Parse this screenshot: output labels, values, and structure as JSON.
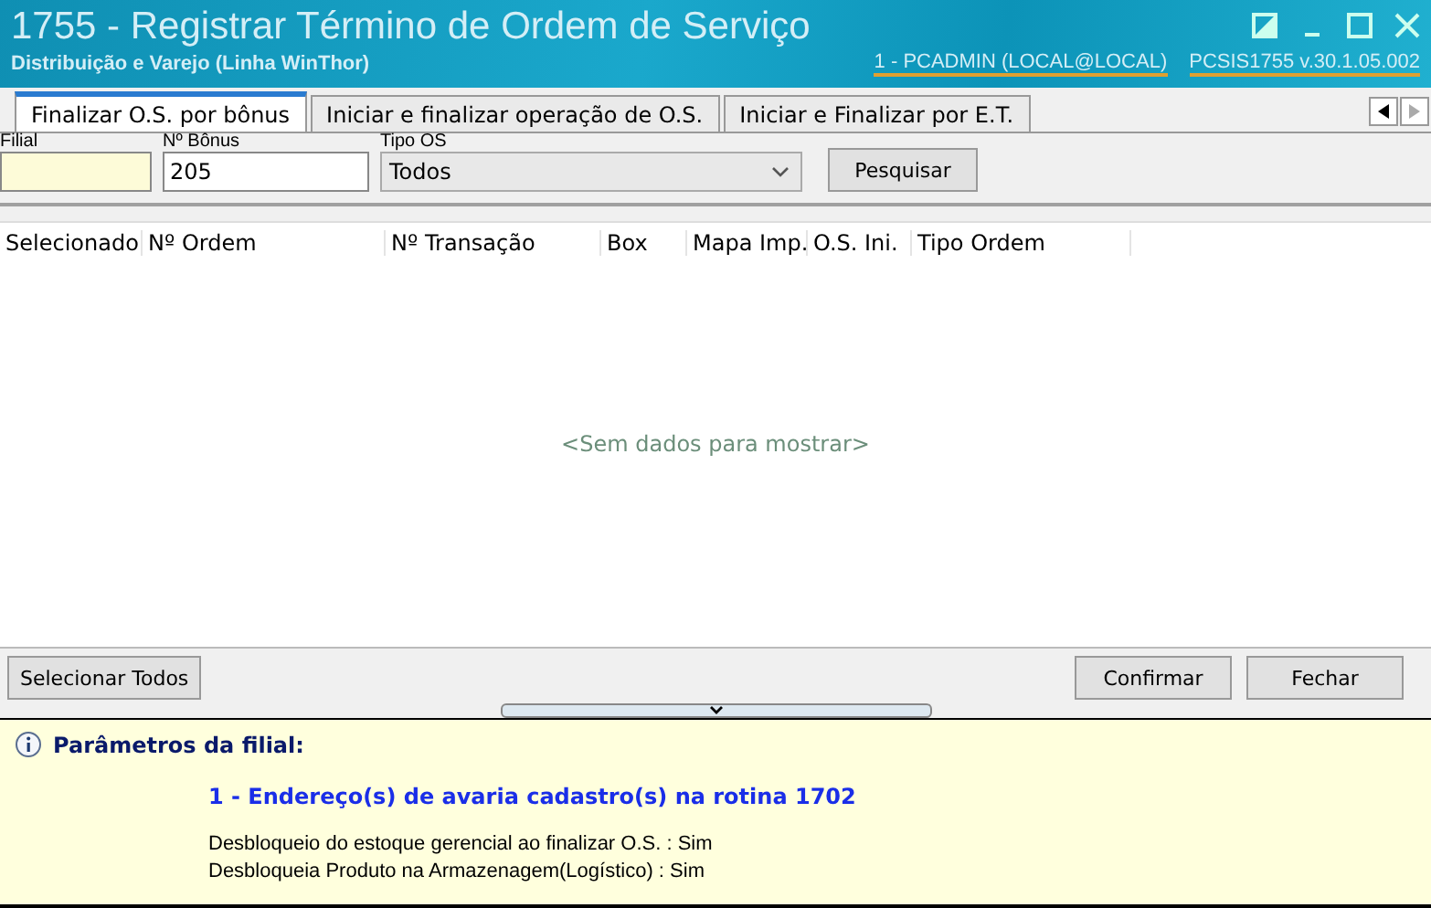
{
  "window": {
    "title": "1755 - Registrar Término de Ordem de Serviço",
    "subtitle": "Distribuição e Varejo (Linha WinThor)",
    "user": "1 - PCADMIN (LOCAL@LOCAL)",
    "version": "PCSIS1755  v.30.1.05.002"
  },
  "tabs": [
    {
      "label": "Finalizar O.S. por bônus",
      "selected": true
    },
    {
      "label": "Iniciar e finalizar operação de O.S.",
      "selected": false
    },
    {
      "label": "Iniciar e Finalizar por E.T.",
      "selected": false
    }
  ],
  "filters": {
    "filial": {
      "label": "Filial"
    },
    "bonus": {
      "label": "Nº Bônus",
      "value": "205"
    },
    "tipo_os": {
      "label": "Tipo OS",
      "value": "Todos"
    },
    "search_button": "Pesquisar"
  },
  "table": {
    "columns": [
      "Selecionado",
      "Nº Ordem",
      "Nº Transação",
      "Box",
      "Mapa Imp.",
      "O.S. Ini.",
      "Tipo Ordem"
    ],
    "empty_text": "<Sem dados para mostrar>"
  },
  "buttons": {
    "select_all": "Selecionar Todos",
    "confirm": "Confirmar",
    "close": "Fechar"
  },
  "info_panel": {
    "title": "Parâmetros da filial:",
    "warning": "1 - Endereço(s) de avaria cadastro(s) na rotina 1702",
    "lines": [
      "Desbloqueio do estoque gerencial ao finalizar O.S. : Sim",
      "Desbloqueia Produto na Armazenagem(Logístico) : Sim"
    ]
  }
}
